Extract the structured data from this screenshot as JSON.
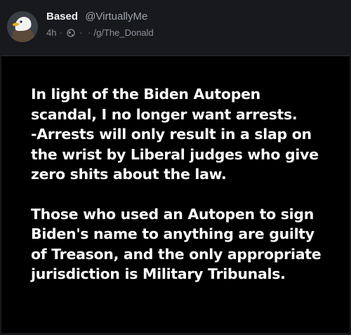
{
  "author": {
    "name": "Based",
    "handle": "@VirtuallyMe"
  },
  "meta": {
    "time": "4h",
    "dot1": "·",
    "dot2": "·",
    "dot3": "·",
    "community": "/g/The_Donald",
    "visibility_icon": "globe-icon"
  },
  "card": {
    "paragraph1": [
      "In light of the Biden Autopen",
      "scandal, I no longer want arrests.",
      "-Arrests will only result in a slap on",
      "the wrist by Liberal judges who give",
      "zero shits about the law."
    ],
    "paragraph2": [
      "Those who used an Autopen to sign",
      "Biden's name to anything are guilty",
      "of Treason, and the only appropriate",
      "jurisdiction is Military Tribunals."
    ]
  }
}
